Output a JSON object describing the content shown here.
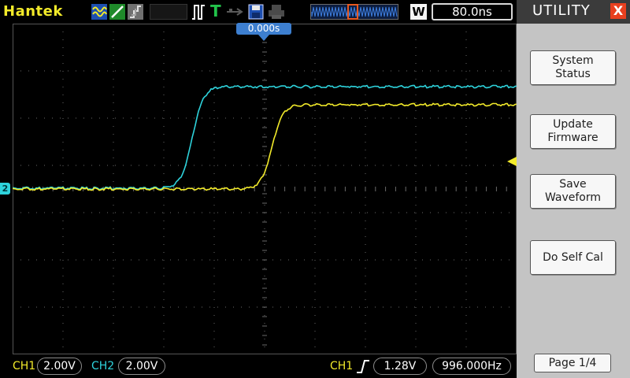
{
  "header": {
    "brand": "Hantek",
    "trigger_mode_letter": "T",
    "timebase_badge": "W",
    "timebase": "80.0ns"
  },
  "screen": {
    "trigger_position": "0.000s",
    "ch2_marker": "2"
  },
  "status_bar": {
    "ch1_label": "CH1",
    "ch1_scale": "2.00V",
    "ch2_label": "CH2",
    "ch2_scale": "2.00V",
    "trigger_source": "CH1",
    "trigger_level": "1.28V",
    "frequency": "996.000Hz"
  },
  "side_menu": {
    "title": "UTILITY",
    "close_glyph": "X",
    "buttons": [
      "System\nStatus",
      "Update\nFirmware",
      "Save\nWaveform",
      "Do Self Cal"
    ],
    "page": "Page 1/4"
  },
  "colors": {
    "ch1": "#f2ea2a",
    "ch2": "#2ed3dc",
    "grid": "#6a6a6a",
    "trigger_marker": "#3d7fd0",
    "accent": "#e8401f"
  }
}
